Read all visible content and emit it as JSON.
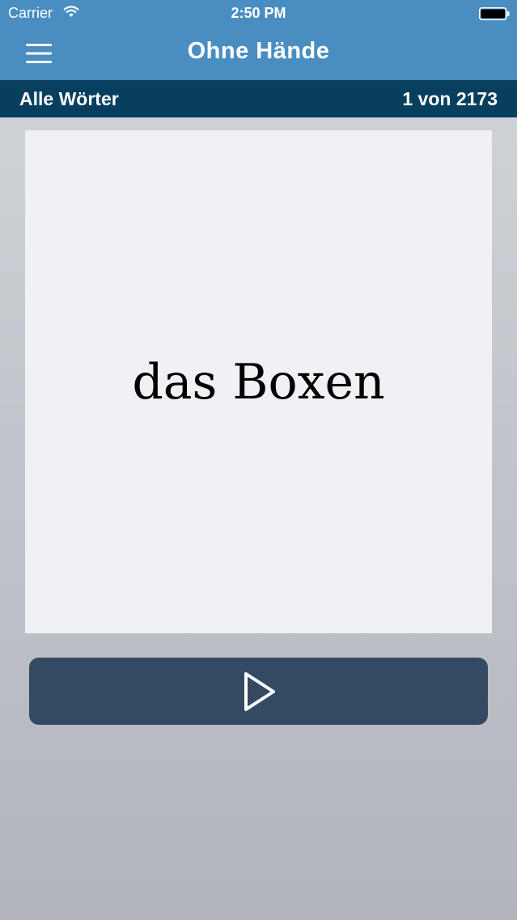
{
  "status_bar": {
    "carrier": "Carrier",
    "time": "2:50 PM"
  },
  "nav": {
    "title": "Ohne Hände",
    "menu_icon": "hamburger-menu-icon"
  },
  "info_bar": {
    "list_name": "Alle Wörter",
    "progress": "1 von 2173"
  },
  "card": {
    "word": "das Boxen"
  },
  "player": {
    "play_icon": "play-icon"
  },
  "colors": {
    "header": "#4a8ec1",
    "info_bar": "#083f5e",
    "card": "#eff1f4",
    "play_button": "#344a62"
  }
}
